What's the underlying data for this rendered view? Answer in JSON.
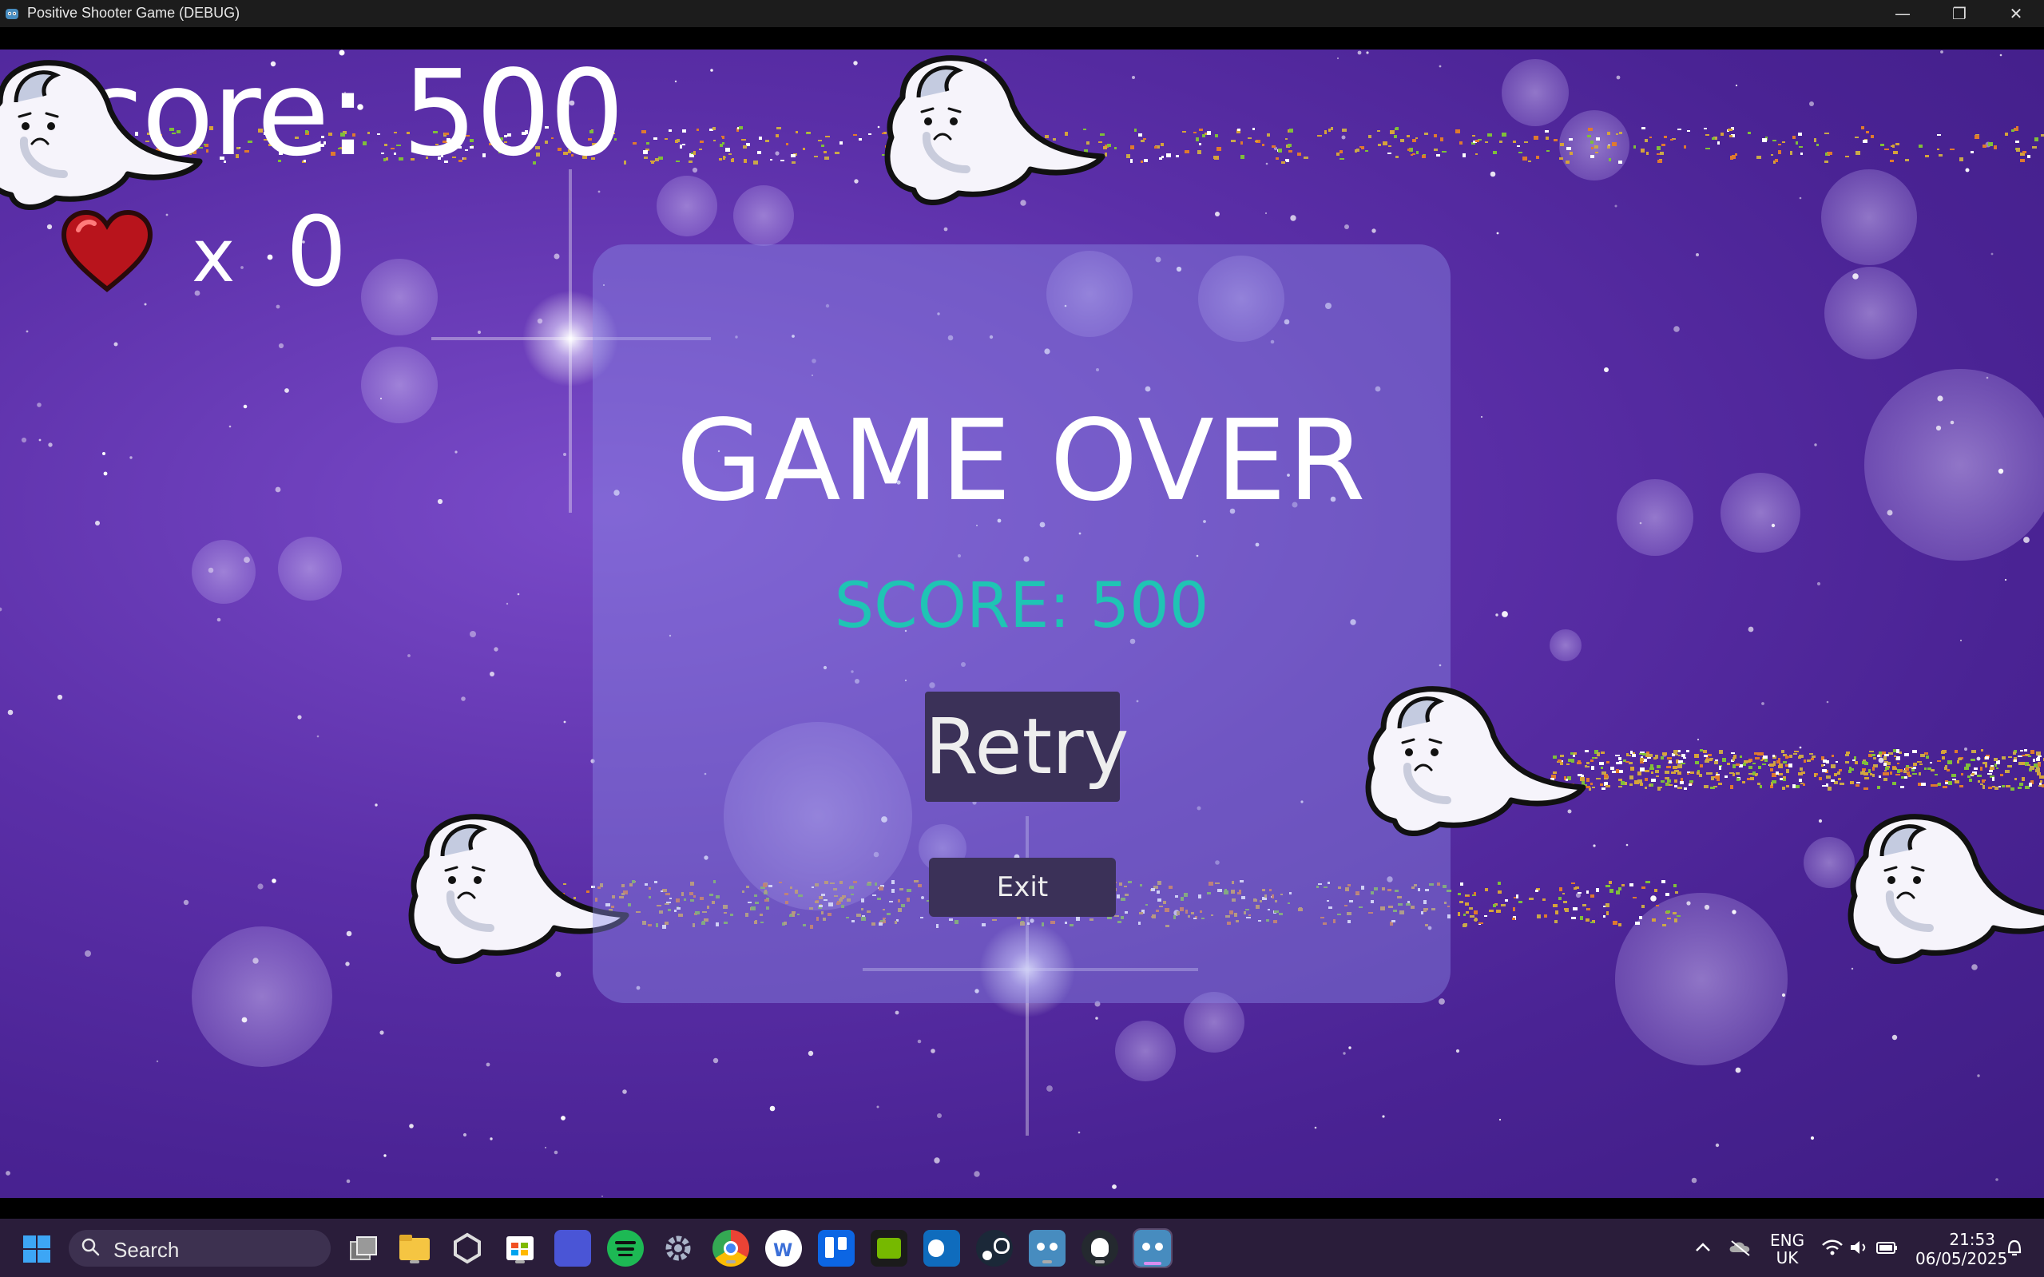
{
  "window": {
    "title": "Positive Shooter Game (DEBUG)",
    "minimize_glyph": "—",
    "restore_glyph": "❐",
    "close_glyph": "✕"
  },
  "hud": {
    "score_text": "Score: 500",
    "lives_x": "x",
    "lives_value": "0"
  },
  "game_over": {
    "title": "GAME OVER",
    "score_text": "SCORE: 500",
    "retry_label": "Retry",
    "exit_label": "Exit"
  },
  "taskbar": {
    "search_placeholder": "Search",
    "lang_line1": "ENG",
    "lang_line2": "UK",
    "time": "21:53",
    "date": "06/05/2025"
  },
  "colors": {
    "accent_score": "#1fc4b4",
    "button_bg": "#3b3158",
    "panel": "rgba(140,140,230,0.42)"
  }
}
